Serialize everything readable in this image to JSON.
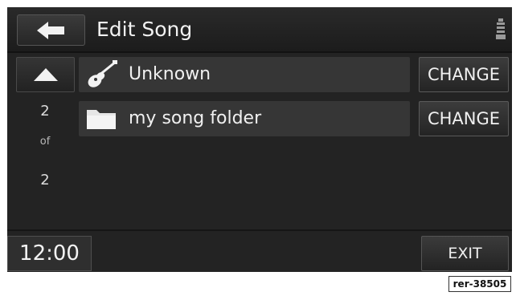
{
  "header": {
    "title": "Edit Song",
    "back_icon": "arrow-left-icon",
    "status_icon": "drive-icon"
  },
  "list": {
    "pager": {
      "up_icon": "triangle-up-icon",
      "current": "2",
      "of_label": "of",
      "total": "2"
    },
    "rows": [
      {
        "icon": "guitar-icon",
        "label": "Unknown",
        "action": "CHANGE"
      },
      {
        "icon": "folder-icon",
        "label": "my song folder",
        "action": "CHANGE"
      }
    ]
  },
  "footer": {
    "clock": "12:00",
    "exit_label": "EXIT"
  },
  "reference_tag": "rer-38505"
}
